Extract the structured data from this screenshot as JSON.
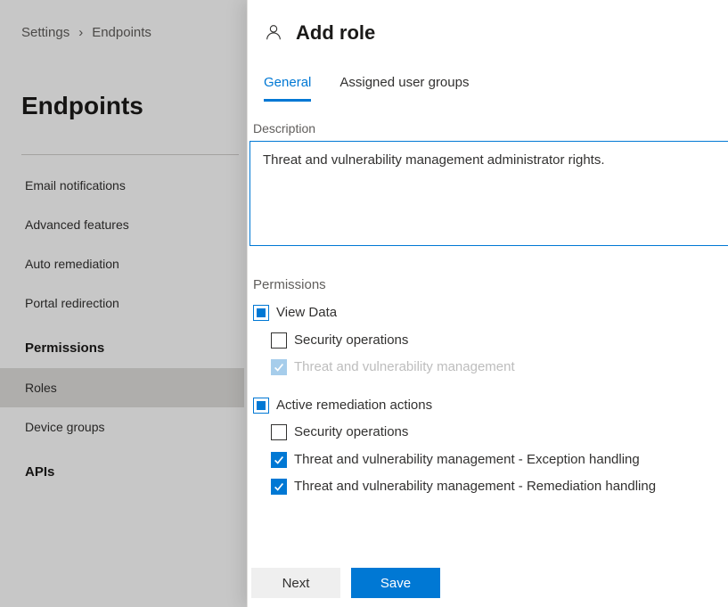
{
  "breadcrumb": {
    "root": "Settings",
    "current": "Endpoints"
  },
  "page": {
    "title": "Endpoints"
  },
  "sidebar": {
    "items": [
      "Email notifications",
      "Advanced features",
      "Auto remediation",
      "Portal redirection"
    ],
    "permissions_header": "Permissions",
    "roles": "Roles",
    "device_groups": "Device groups",
    "apis_header": "APIs"
  },
  "panel": {
    "title": "Add role",
    "tabs": {
      "general": "General",
      "assigned": "Assigned user groups"
    },
    "description_label": "Description",
    "description_value": "Threat and vulnerability management administrator rights.",
    "permissions_label": "Permissions",
    "permissions": {
      "view_data": "View Data",
      "view_security_ops": "Security operations",
      "view_tvm": "Threat and vulnerability management",
      "active_remediation": "Active remediation actions",
      "ar_security_ops": "Security operations",
      "ar_tvm_exception": "Threat and vulnerability management - Exception handling",
      "ar_tvm_remediation": "Threat and vulnerability management - Remediation handling"
    },
    "buttons": {
      "next": "Next",
      "save": "Save"
    }
  }
}
